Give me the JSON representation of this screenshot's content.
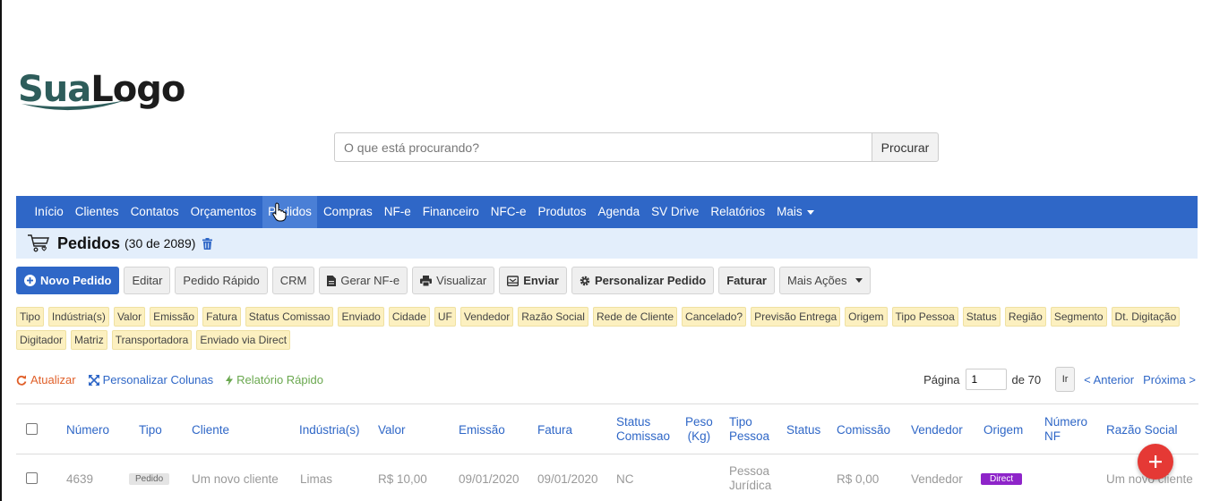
{
  "logo": {
    "part1": "Sua",
    "part2": "Logo"
  },
  "search": {
    "placeholder": "O que está procurando?",
    "button": "Procurar"
  },
  "nav": {
    "items": [
      "Início",
      "Clientes",
      "Contatos",
      "Orçamentos",
      "Pedidos",
      "Compras",
      "NF-e",
      "Financeiro",
      "NFC-e",
      "Produtos",
      "Agenda",
      "SV Drive",
      "Relatórios"
    ],
    "more": "Mais",
    "active": "Pedidos"
  },
  "page": {
    "title": "Pedidos",
    "count": "(30 de 2089)"
  },
  "toolbar": {
    "novo_pedido": "Novo Pedido",
    "editar": "Editar",
    "pedido_rapido": "Pedido Rápido",
    "crm": "CRM",
    "gerar_nfe": "Gerar NF-e",
    "visualizar": "Visualizar",
    "enviar": "Enviar",
    "personalizar_pedido": "Personalizar Pedido",
    "faturar": "Faturar",
    "mais_acoes": "Mais Ações"
  },
  "filters": [
    "Tipo",
    "Indústria(s)",
    "Valor",
    "Emissão",
    "Fatura",
    "Status Comissao",
    "Enviado",
    "Cidade",
    "UF",
    "Vendedor",
    "Razão Social",
    "Rede de Cliente",
    "Cancelado?",
    "Previsão Entrega",
    "Origem",
    "Tipo Pessoa",
    "Status",
    "Região",
    "Segmento",
    "Dt. Digitação",
    "Digitador",
    "Matriz",
    "Transportadora",
    "Enviado via Direct"
  ],
  "actions": {
    "atualizar": "Atualizar",
    "personalizar_colunas": "Personalizar Colunas",
    "relatorio_rapido": "Relatório Rápido"
  },
  "pager": {
    "label": "Página",
    "page": "1",
    "of": "de 70",
    "go": "Ir",
    "prev": "< Anterior",
    "next": "Próxima >"
  },
  "table": {
    "headers": {
      "numero": "Número",
      "tipo": "Tipo",
      "cliente": "Cliente",
      "industria": "Indústria(s)",
      "valor": "Valor",
      "emissao": "Emissão",
      "fatura": "Fatura",
      "status_comissao_1": "Status",
      "status_comissao_2": "Comissao",
      "peso_1": "Peso",
      "peso_2": "(Kg)",
      "tipo_pessoa_1": "Tipo",
      "tipo_pessoa_2": "Pessoa",
      "status": "Status",
      "comissao": "Comissão",
      "vendedor": "Vendedor",
      "origem": "Origem",
      "numero_nf_1": "Número",
      "numero_nf_2": "NF",
      "razao_social": "Razão Social"
    },
    "rows": [
      {
        "numero": "4639",
        "tipo": "Pedido",
        "cliente": "Um novo cliente",
        "industria": "Limas",
        "valor": "R$ 10,00",
        "emissao": "09/01/2020",
        "fatura": "09/01/2020",
        "status_comissao": "NC",
        "tipo_pessoa_1": "Pessoa",
        "tipo_pessoa_2": "Jurídica",
        "comissao": "R$ 0,00",
        "vendedor": "Vendedor",
        "origem": "Direct",
        "razao_social": "Um novo cliente"
      }
    ]
  },
  "colors": {
    "primary": "#2f67c7",
    "chip": "#fcf0c0",
    "fab": "#e53935",
    "direct": "#8e24c9",
    "atualizar": "#e0602a",
    "relatorio": "#6aa84f"
  }
}
